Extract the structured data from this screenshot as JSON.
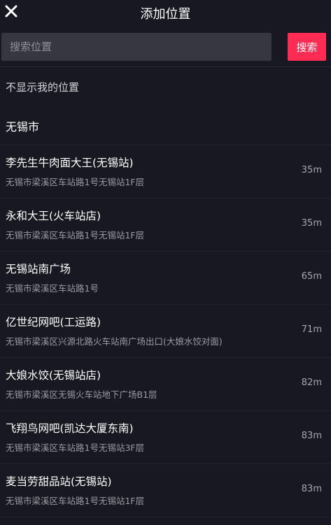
{
  "header": {
    "title": "添加位置",
    "close_icon": "close-icon"
  },
  "search": {
    "placeholder": "搜索位置",
    "button_label": "搜索"
  },
  "options": {
    "hide_location": "不显示我的位置",
    "city": "无锡市"
  },
  "locations": [
    {
      "name": "李先生牛肉面大王(无锡站)",
      "address": "无锡市梁溪区车站路1号无锡站1F层",
      "distance": "35m"
    },
    {
      "name": "永和大王(火车站店)",
      "address": "无锡市梁溪区车站路1号无锡站1F层",
      "distance": "35m"
    },
    {
      "name": "无锡站南广场",
      "address": "无锡市梁溪区车站路1号",
      "distance": "65m"
    },
    {
      "name": "亿世纪网吧(工运路)",
      "address": "无锡市梁溪区兴源北路火车站南广场出口(大娘水饺对面)",
      "distance": "71m"
    },
    {
      "name": "大娘水饺(无锡站店)",
      "address": "无锡市梁溪区无锡火车站地下广场B1层",
      "distance": "82m"
    },
    {
      "name": "飞翔鸟网吧(凯达大厦东南)",
      "address": "无锡市梁溪区车站路1号无锡站3F层",
      "distance": "83m"
    },
    {
      "name": "麦当劳甜品站(无锡站)",
      "address": "无锡市梁溪区车站路1号无锡站1F层",
      "distance": "83m"
    }
  ],
  "colors": {
    "background": "#171821",
    "accent": "#fe2c55",
    "input_bg": "#363741"
  }
}
